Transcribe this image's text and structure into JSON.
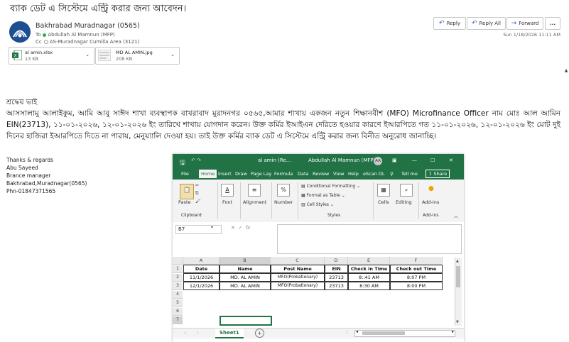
{
  "email": {
    "subject": "ব্যাক ডেট এ সিস্টেমে এন্ট্রি করার জন্য আবেদন।",
    "sender": "Bakhrabad Muradnagar (0565)",
    "to_label": "To",
    "to": "Abdullah Al Mamnun (MFP)",
    "cc_label": "Cc",
    "cc": "AS-Muradnagar Cumilla Area (3121)",
    "date": "Sun 1/18/2026 11:11 AM",
    "actions": {
      "reply": "Reply",
      "reply_all": "Reply All",
      "forward": "Forward",
      "more": "..."
    },
    "attachments": [
      {
        "name": "al amin.xlsx",
        "size": "13 KB"
      },
      {
        "name": "MD AL AMIN.jpg",
        "size": "208 KB"
      }
    ],
    "greeting": "শ্রদ্ধেয় ভাই",
    "body": "আসসালামু আলাইকুম, আমি আবু সাঈদ শাখা ব্যবস্থাপক বাখরাবাদ মুরাদনগর ০৫৬৫,আমার শাখায় একজন নতুন শিক্ষানবীশ (MFO) Microfinance Officer নাম মোঃ আল আমিন EIN(23713), ১১-০১-২০২৬, ১২-০১-২০২৬ ইং তারিখে শাখায় যোগদান করেন। উক্ত কর্মির ইআইএন দেরিতে হওয়ার কারণে ইআরপিতে গত ১১-০১-২০২৬, ১২-০১-২০২৬ ইং মোট দুই দিনের হাজিরা ইআরপিতে দিতে না পারায়, মেনুয়্যালি দেওয়া হয়। তাই উক্ত কর্মির ব্যাক ডেট এ সিস্টেমে এন্ট্রি করার জন্য বিনীত অনুরোধ জানাচ্ছি।",
    "signature": [
      "Thanks & regards",
      "Abu Sayeed",
      "Brance manager",
      "Bakhrabad,Muradnagar(0565)",
      "Phn-01847371565"
    ]
  },
  "excel": {
    "title": "al amin (Re...",
    "user": "Abdullah Al Mamnun (MFP)",
    "user_initials": "AA",
    "tabs": [
      "File",
      "Home",
      "Insert",
      "Draw",
      "Page Lay",
      "Formula",
      "Data",
      "Review",
      "View",
      "Help",
      "eScan DL",
      "Tell me",
      "Share"
    ],
    "ribbon": {
      "paste": "Paste",
      "clipboard": "Clipboard",
      "font": "Font",
      "alignment": "Alignment",
      "number": "Number",
      "conditional_formatting": "Conditional Formatting",
      "format_as_table": "Format as Table",
      "cell_styles": "Cell Styles",
      "styles": "Styles",
      "cells": "Cells",
      "editing": "Editing",
      "addins": "Add-ins",
      "addins_group": "Add-ins"
    },
    "name_box": "B7",
    "fx": "fx",
    "columns": [
      "A",
      "B",
      "C",
      "D",
      "E",
      "F"
    ],
    "rows": [
      "1",
      "2",
      "3",
      "4",
      "5",
      "6",
      "7"
    ],
    "headers": [
      "Date",
      "Name",
      "Post Name",
      "EIN",
      "Check in Time",
      "Check out Time"
    ],
    "data": [
      [
        "11/1/2026",
        "MD. AL AMIN",
        "MFO(Probationary)",
        "23713",
        "8::41 AM",
        "8:07 PM"
      ],
      [
        "12/1/2026",
        "MD. AL AMIN",
        "MFO(Probationary)",
        "23713",
        "8:30 AM",
        "8:00 PM"
      ]
    ],
    "sheet_tab": "Sheet1",
    "add_sheet": "+"
  },
  "colors": {
    "excel_green": "#217346",
    "accent_blue": "#2b63b8"
  }
}
